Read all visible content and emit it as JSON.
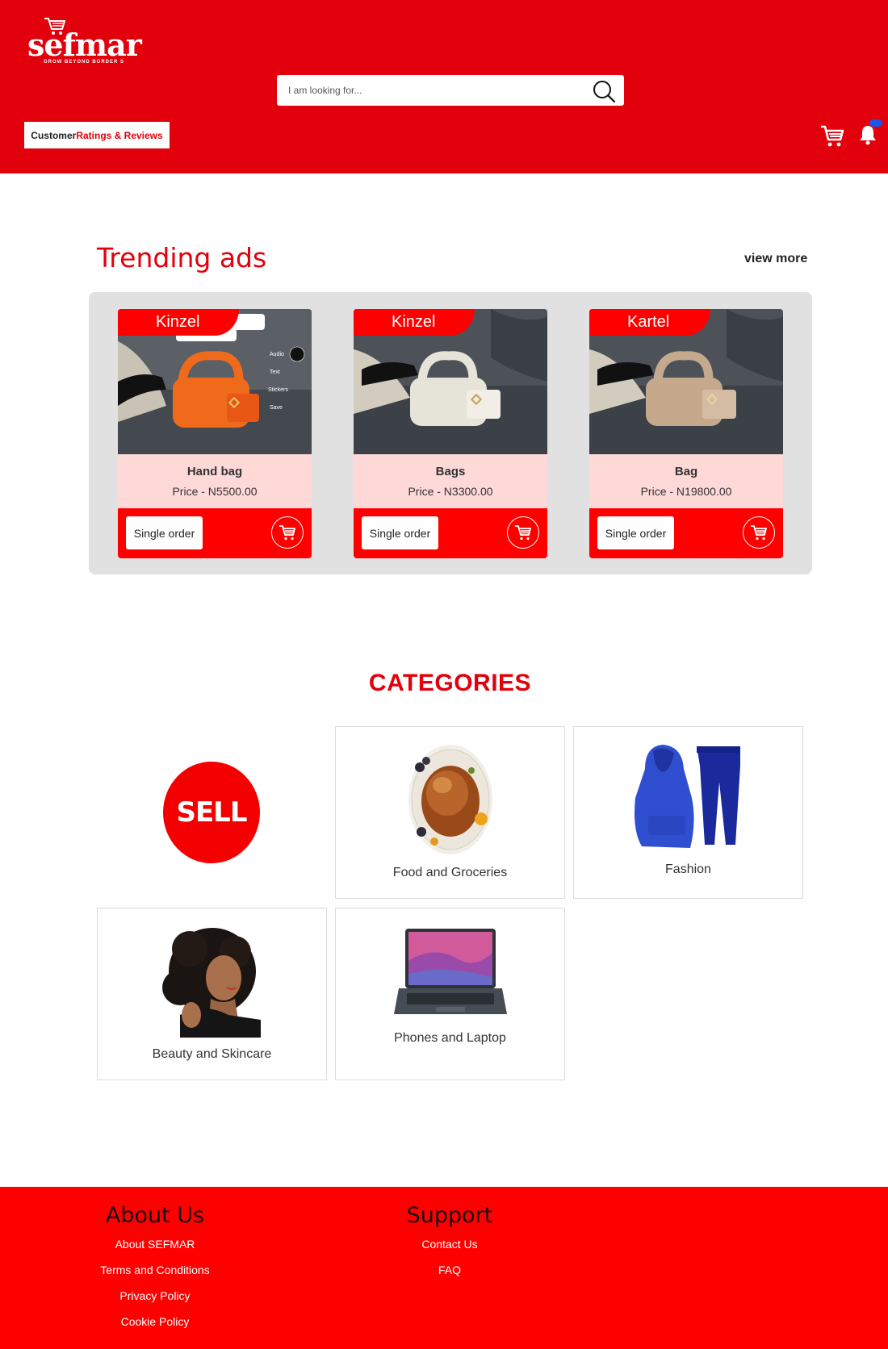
{
  "brand": {
    "logo_text": "sefmar",
    "tagline": "GROW BEYOND BORDER S"
  },
  "header": {
    "search_placeholder": "I am looking for...",
    "ratings_label_a": "Customer",
    "ratings_label_b": "Ratings & Reviews"
  },
  "icons": {
    "search": "search-icon",
    "cart": "cart-icon",
    "bell": "bell-icon"
  },
  "colors": {
    "primary": "#e1000b",
    "card_info": "#ffd8d8",
    "panel": "#e1e1e1",
    "badge": "#1a56e8"
  },
  "trending": {
    "title": "Trending ads",
    "view_more": "view more",
    "items": [
      {
        "seller": "Kinzel",
        "name": "Hand bag",
        "price": "Price - N5500.00",
        "order_label": "Single order",
        "bag_color": "#f06a1c"
      },
      {
        "seller": "Kinzel",
        "name": "Bags",
        "price": "Price - N3300.00",
        "order_label": "Single order",
        "bag_color": "#e6e3d8"
      },
      {
        "seller": "Kartel",
        "name": "Bag",
        "price": "Price - N19800.00",
        "order_label": "Single order",
        "bag_color": "#c5a98c"
      }
    ]
  },
  "categories": {
    "title": "CATEGORIES",
    "sell_label": "SELL",
    "items": [
      {
        "label": "Food and Groceries"
      },
      {
        "label": "Fashion"
      },
      {
        "label": "Beauty and Skincare"
      },
      {
        "label": "Phones and Laptop"
      }
    ]
  },
  "footer": {
    "about": {
      "title": "About Us",
      "links": [
        "About SEFMAR",
        "Terms and Conditions",
        "Privacy Policy",
        "Cookie Policy"
      ]
    },
    "support": {
      "title": "Support",
      "links": [
        "Contact Us",
        "FAQ"
      ]
    }
  }
}
